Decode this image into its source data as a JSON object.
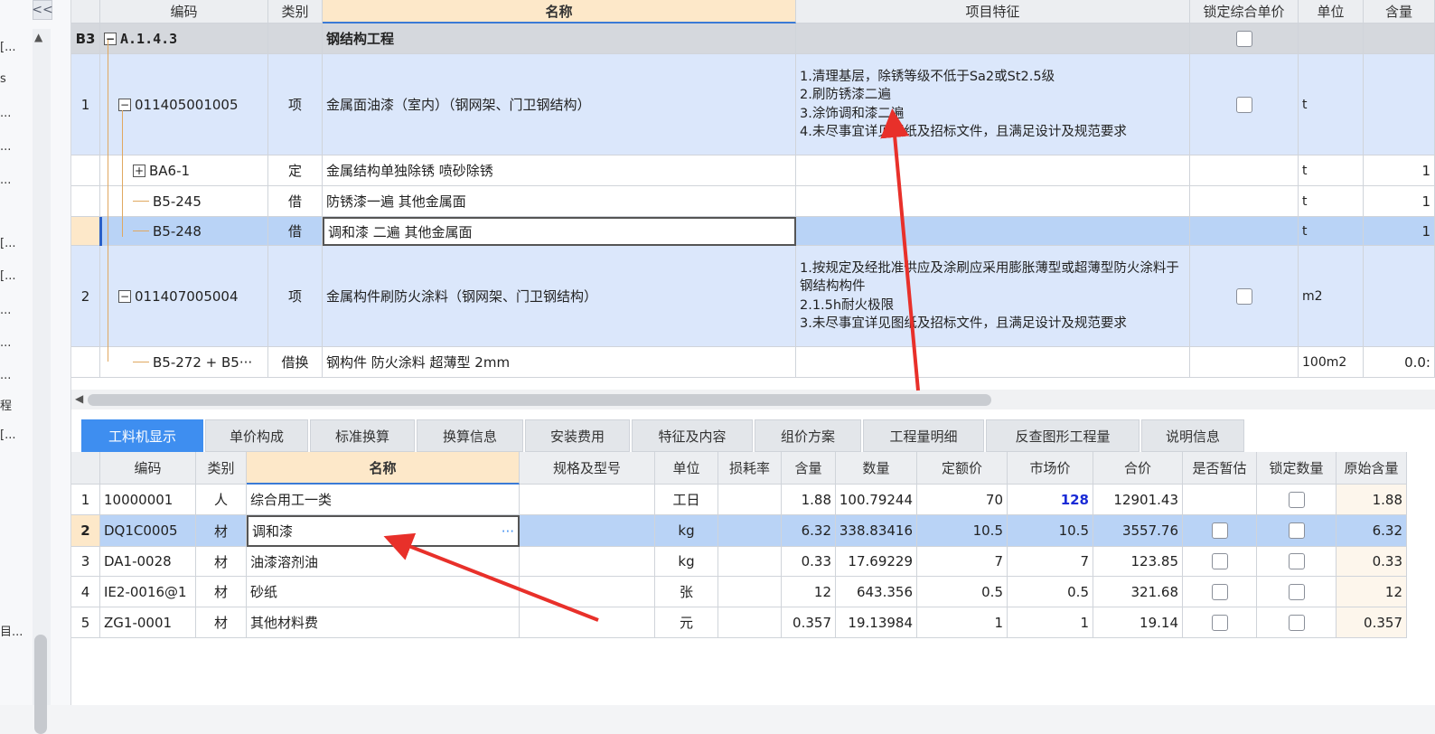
{
  "nav": {
    "collapse_glyph": "<<",
    "fragments": [
      "[...",
      "s",
      "...",
      "...",
      "...",
      "[...",
      "[...",
      "...",
      "...",
      "...",
      "程",
      "[...",
      "目..."
    ]
  },
  "upper": {
    "headers": [
      "编码",
      "类别",
      "名称",
      "项目特征",
      "锁定综合单价",
      "单位",
      "含量"
    ],
    "rows": [
      {
        "idx": "B3",
        "code": "A.1.4.3",
        "type": "",
        "name": "钢结构工程",
        "feature": "",
        "unit": "",
        "qty": "",
        "checkbox": true
      },
      {
        "idx": "1",
        "code": "011405001005",
        "type": "项",
        "name": "金属面油漆（室内）（钢网架、门卫钢结构）",
        "feature": "1.清理基层，除锈等级不低于Sa2或St2.5级\n2.刷防锈漆二遍\n3.涂饰调和漆二遍\n4.未尽事宜详见图纸及招标文件，且满足设计及规范要求",
        "unit": "t",
        "qty": "",
        "checkbox": true
      },
      {
        "idx": "",
        "code": "BA6-1",
        "type": "定",
        "name": "金属结构单独除锈 喷砂除锈",
        "feature": "",
        "unit": "t",
        "qty": "1",
        "checkbox": false
      },
      {
        "idx": "",
        "code": "B5-245",
        "type": "借",
        "name": "防锈漆一遍 其他金属面",
        "feature": "",
        "unit": "t",
        "qty": "1",
        "checkbox": false
      },
      {
        "idx": "",
        "code": "B5-248",
        "type": "借",
        "name": "调和漆 二遍 其他金属面",
        "feature": "",
        "unit": "t",
        "qty": "1",
        "checkbox": false
      },
      {
        "idx": "2",
        "code": "011407005004",
        "type": "项",
        "name": "金属构件刷防火涂料（钢网架、门卫钢结构）",
        "feature": "1.按规定及经批准供应及涂刷应采用膨胀薄型或超薄型防火涂料于钢结构构件\n2.1.5h耐火极限\n3.未尽事宜详见图纸及招标文件，且满足设计及规范要求",
        "unit": "m2",
        "qty": "",
        "checkbox": true
      },
      {
        "idx": "",
        "code": "B5-272 + B5···",
        "type": "借换",
        "name": "钢构件 防火涂料 超薄型 2mm",
        "feature": "",
        "unit": "100m2",
        "qty": "0.0:",
        "checkbox": false
      }
    ]
  },
  "tabs": [
    "工料机显示",
    "单价构成",
    "标准换算",
    "换算信息",
    "安装费用",
    "特征及内容",
    "组价方案",
    "工程量明细",
    "反查图形工程量",
    "说明信息"
  ],
  "lower": {
    "headers": [
      "编码",
      "类别",
      "名称",
      "规格及型号",
      "单位",
      "损耗率",
      "含量",
      "数量",
      "定额价",
      "市场价",
      "合价",
      "是否暂估",
      "锁定数量",
      "原始含量"
    ],
    "rows": [
      {
        "idx": "1",
        "code": "10000001",
        "type": "人",
        "name": "综合用工一类",
        "spec": "",
        "unit": "工日",
        "loss": "",
        "qty": "1.88",
        "amount": "100.79244",
        "price": "70",
        "market": "128",
        "total": "12901.43",
        "est": false,
        "lock": true,
        "orig": "1.88"
      },
      {
        "idx": "2",
        "code": "DQ1C0005",
        "type": "材",
        "name": "调和漆",
        "spec": "",
        "unit": "kg",
        "loss": "",
        "qty": "6.32",
        "amount": "338.83416",
        "price": "10.5",
        "market": "10.5",
        "total": "3557.76",
        "est": true,
        "lock": true,
        "orig": "6.32"
      },
      {
        "idx": "3",
        "code": "DA1-0028",
        "type": "材",
        "name": "油漆溶剂油",
        "spec": "",
        "unit": "kg",
        "loss": "",
        "qty": "0.33",
        "amount": "17.69229",
        "price": "7",
        "market": "7",
        "total": "123.85",
        "est": true,
        "lock": true,
        "orig": "0.33"
      },
      {
        "idx": "4",
        "code": "IE2-0016@1",
        "type": "材",
        "name": "砂纸",
        "spec": "",
        "unit": "张",
        "loss": "",
        "qty": "12",
        "amount": "643.356",
        "price": "0.5",
        "market": "0.5",
        "total": "321.68",
        "est": true,
        "lock": true,
        "orig": "12"
      },
      {
        "idx": "5",
        "code": "ZG1-0001",
        "type": "材",
        "name": "其他材料费",
        "spec": "",
        "unit": "元",
        "loss": "",
        "qty": "0.357",
        "amount": "19.13984",
        "price": "1",
        "market": "1",
        "total": "19.14",
        "est": true,
        "lock": true,
        "orig": "0.357"
      }
    ],
    "ellipsis": "···"
  },
  "colors": {
    "accent": "#3e8ef0",
    "arrow": "#e8302a",
    "market_highlight": "#1a2bd6"
  }
}
